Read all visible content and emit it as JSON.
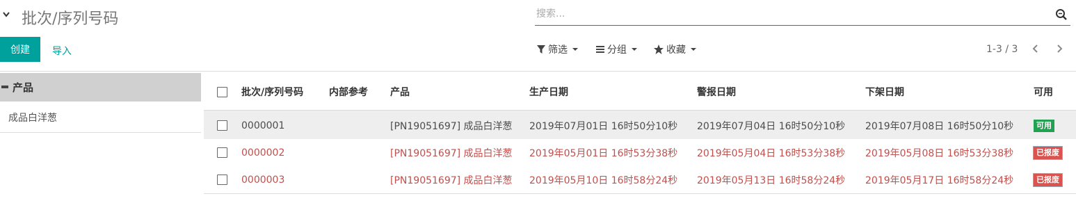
{
  "header": {
    "title": "批次/序列号码",
    "search_placeholder": "搜索..."
  },
  "toolbar": {
    "create_label": "创建",
    "import_label": "导入",
    "filter_label": "筛选",
    "group_label": "分组",
    "favorites_label": "收藏",
    "pager_value": "1-3 / 3"
  },
  "side_panel": {
    "category_label": "产品",
    "items": [
      "成品白洋葱"
    ]
  },
  "table": {
    "columns": [
      "批次/序列号码",
      "内部参考",
      "产品",
      "生产日期",
      "警报日期",
      "下架日期",
      "可用"
    ],
    "rows": [
      {
        "lot": "0000001",
        "ref": "",
        "product": "[PN19051697] 成品白洋葱",
        "production_date": "2019年07月01日 16时50分10秒",
        "alert_date": "2019年07月04日 16时50分10秒",
        "removal_date": "2019年07月08日 16时50分10秒",
        "status": "可用",
        "expired": false
      },
      {
        "lot": "0000002",
        "ref": "",
        "product": "[PN19051697] 成品白洋葱",
        "production_date": "2019年05月01日 16时53分38秒",
        "alert_date": "2019年05月04日 16时53分38秒",
        "removal_date": "2019年05月08日 16时53分38秒",
        "status": "已报废",
        "expired": true
      },
      {
        "lot": "0000003",
        "ref": "",
        "product": "[PN19051697] 成品白洋葱",
        "production_date": "2019年05月10日 16时58分24秒",
        "alert_date": "2019年05月13日 16时58分24秒",
        "removal_date": "2019年05月17日 16时58分24秒",
        "status": "已报废",
        "expired": true
      }
    ]
  },
  "colors": {
    "primary": "#00a09d",
    "expired_text": "#c0504d",
    "available_badge": "#21a151",
    "expired_badge": "#d9534f"
  }
}
